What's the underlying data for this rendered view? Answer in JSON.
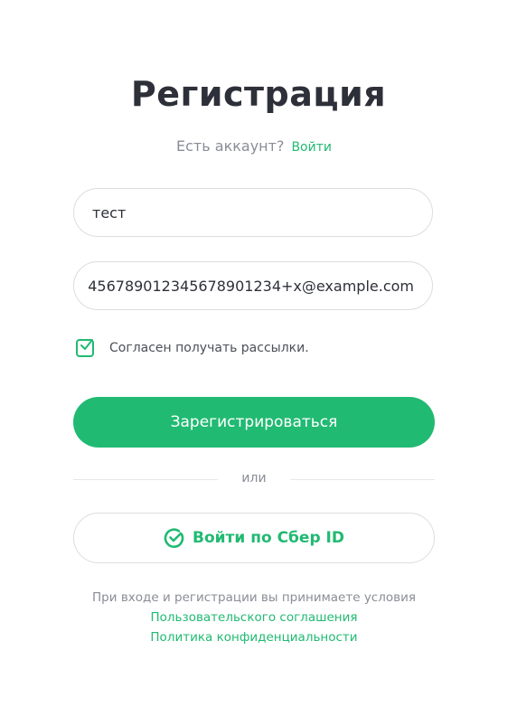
{
  "title": "Регистрация",
  "login_prompt": {
    "text": "Есть аккаунт?",
    "link": "Войти"
  },
  "name_field": {
    "value": "тест"
  },
  "email_field": {
    "value": "456789012345678901234+x@example.com"
  },
  "newsletter": {
    "label": "Согласен получать рассылки.",
    "checked": true
  },
  "register_button": "Зарегистрироваться",
  "or_label": "или",
  "sber_button": {
    "label": "Войти по Сбер ID",
    "icon": "sber-check-icon"
  },
  "terms": {
    "text": "При входе и регистрации вы принимаете условия",
    "agreement_link": "Пользовательского соглашения",
    "privacy_link": "Политика конфиденциальности"
  },
  "colors": {
    "accent": "#21ba72",
    "text": "#2d3039",
    "muted": "#8a8d96"
  }
}
